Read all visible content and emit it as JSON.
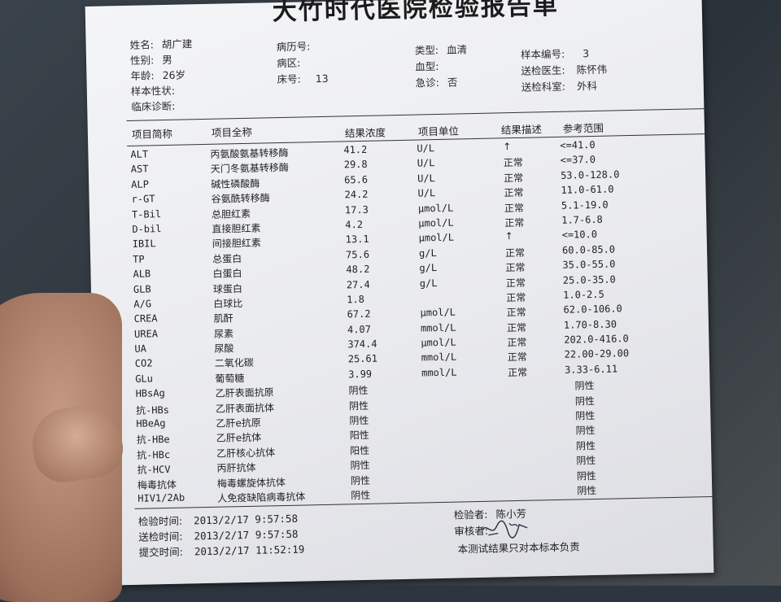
{
  "report": {
    "title": "大竹时代医院检验报告单",
    "patient": {
      "name_label": "姓名:",
      "name": "胡广建",
      "sex_label": "性别:",
      "sex": "男",
      "age_label": "年龄:",
      "age": "26岁",
      "sample_state_label": "样本性状:",
      "diagnosis_label": "临床诊断:"
    },
    "record": {
      "case_no_label": "病历号:",
      "ward_label": "病区:",
      "bed_label": "床号:",
      "bed": "13"
    },
    "sample": {
      "type_label": "类型:",
      "type": "血清",
      "blood_type_label": "血型:",
      "emergency_label": "急诊:",
      "emergency": "否"
    },
    "submission": {
      "sample_no_label": "样本编号:",
      "sample_no": "3",
      "doctor_label": "送检医生:",
      "doctor": "陈怀伟",
      "dept_label": "送检科室:",
      "dept": "外科"
    },
    "columns": [
      "项目简称",
      "项目全称",
      "结果浓度",
      "项目单位",
      "结果描述",
      "参考范围"
    ],
    "rows": [
      {
        "code": "ALT",
        "name": "丙氨酸氨基转移酶",
        "value": "41.2",
        "unit": "U/L",
        "desc": "↑",
        "ref": "<=41.0"
      },
      {
        "code": "AST",
        "name": "天门冬氨基转移酶",
        "value": "29.8",
        "unit": "U/L",
        "desc": "正常",
        "ref": "<=37.0"
      },
      {
        "code": "ALP",
        "name": "碱性磷酸酶",
        "value": "65.6",
        "unit": "U/L",
        "desc": "正常",
        "ref": "53.0-128.0"
      },
      {
        "code": "r-GT",
        "name": "谷氨酰转移酶",
        "value": "24.2",
        "unit": "U/L",
        "desc": "正常",
        "ref": "11.0-61.0"
      },
      {
        "code": "T-Bil",
        "name": "总胆红素",
        "value": "17.3",
        "unit": "μmol/L",
        "desc": "正常",
        "ref": "5.1-19.0"
      },
      {
        "code": "D-bil",
        "name": "直接胆红素",
        "value": "4.2",
        "unit": "μmol/L",
        "desc": "正常",
        "ref": "1.7-6.8"
      },
      {
        "code": "IBIL",
        "name": "间接胆红素",
        "value": "13.1",
        "unit": "μmol/L",
        "desc": "↑",
        "ref": "<=10.0"
      },
      {
        "code": "TP",
        "name": "总蛋白",
        "value": "75.6",
        "unit": "g/L",
        "desc": "正常",
        "ref": "60.0-85.0"
      },
      {
        "code": "ALB",
        "name": "白蛋白",
        "value": "48.2",
        "unit": "g/L",
        "desc": "正常",
        "ref": "35.0-55.0"
      },
      {
        "code": "GLB",
        "name": "球蛋白",
        "value": "27.4",
        "unit": "g/L",
        "desc": "正常",
        "ref": "25.0-35.0"
      },
      {
        "code": "A/G",
        "name": "白球比",
        "value": "1.8",
        "unit": "",
        "desc": "正常",
        "ref": "1.0-2.5"
      },
      {
        "code": "CREA",
        "name": "肌酐",
        "value": "67.2",
        "unit": "μmol/L",
        "desc": "正常",
        "ref": "62.0-106.0"
      },
      {
        "code": "UREA",
        "name": "尿素",
        "value": "4.07",
        "unit": "mmol/L",
        "desc": "正常",
        "ref": "1.70-8.30"
      },
      {
        "code": "UA",
        "name": "尿酸",
        "value": "374.4",
        "unit": "μmol/L",
        "desc": "正常",
        "ref": "202.0-416.0"
      },
      {
        "code": "CO2",
        "name": "二氧化碳",
        "value": "25.61",
        "unit": "mmol/L",
        "desc": "正常",
        "ref": "22.00-29.00"
      },
      {
        "code": "GLu",
        "name": "葡萄糖",
        "value": "3.99",
        "unit": "mmol/L",
        "desc": "正常",
        "ref": "3.33-6.11"
      },
      {
        "code": "HBsAg",
        "name": "乙肝表面抗原",
        "value": "阴性",
        "unit": "",
        "desc": "",
        "ref": "阴性"
      },
      {
        "code": "抗-HBs",
        "name": "乙肝表面抗体",
        "value": "阴性",
        "unit": "",
        "desc": "",
        "ref": "阴性"
      },
      {
        "code": "HBeAg",
        "name": "乙肝e抗原",
        "value": "阴性",
        "unit": "",
        "desc": "",
        "ref": "阴性"
      },
      {
        "code": "抗-HBe",
        "name": "乙肝e抗体",
        "value": "阳性",
        "unit": "",
        "desc": "",
        "ref": "阴性"
      },
      {
        "code": "抗-HBc",
        "name": "乙肝核心抗体",
        "value": "阳性",
        "unit": "",
        "desc": "",
        "ref": "阴性"
      },
      {
        "code": "抗-HCV",
        "name": "丙肝抗体",
        "value": "阴性",
        "unit": "",
        "desc": "",
        "ref": "阴性"
      },
      {
        "code": "梅毒抗体",
        "name": "梅毒螺旋体抗体",
        "value": "阴性",
        "unit": "",
        "desc": "",
        "ref": "阴性"
      },
      {
        "code": "HIV1/2Ab",
        "name": "人免疫缺陷病毒抗体",
        "value": "阴性",
        "unit": "",
        "desc": "",
        "ref": "阴性"
      }
    ],
    "footer": {
      "test_time_label": "检验时间:",
      "test_time": "2013/2/17  9:57:58",
      "send_time_label": "送检时间:",
      "send_time": "2013/2/17  9:57:58",
      "submit_time_label": "提交时间:",
      "submit_time": "2013/2/17  11:52:19",
      "examiner_label": "检验者:",
      "examiner": "陈小芳",
      "reviewer_label": "审核者:",
      "disclaimer": "本测试结果只对本标本负责"
    }
  }
}
